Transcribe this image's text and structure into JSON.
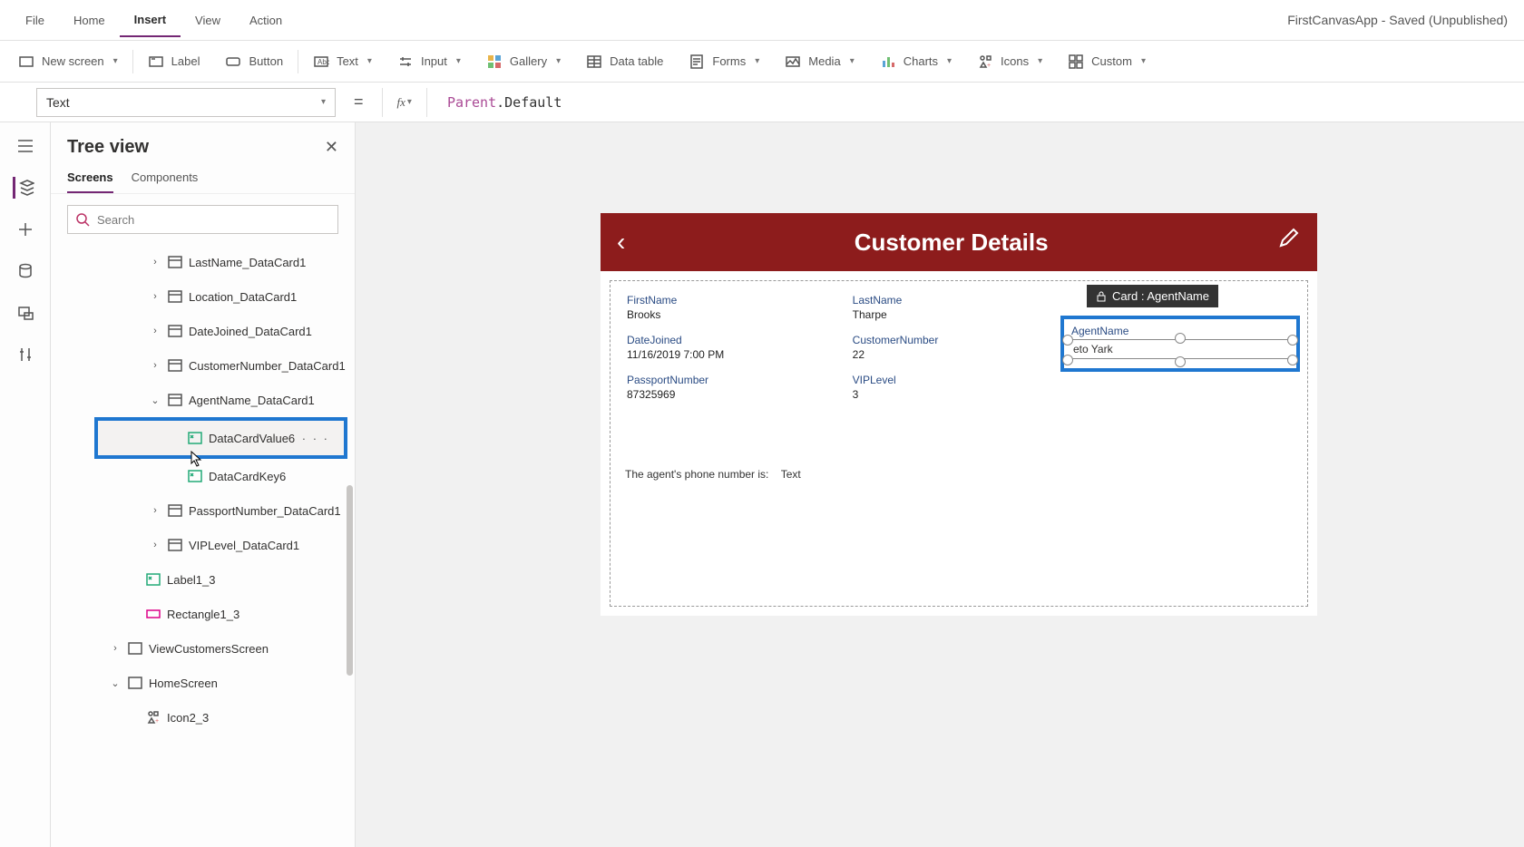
{
  "app": {
    "title": "FirstCanvasApp - Saved (Unpublished)"
  },
  "menu": {
    "file": "File",
    "home": "Home",
    "insert": "Insert",
    "view": "View",
    "action": "Action"
  },
  "ribbon": {
    "newscreen": "New screen",
    "label": "Label",
    "button": "Button",
    "text": "Text",
    "input": "Input",
    "gallery": "Gallery",
    "datatable": "Data table",
    "forms": "Forms",
    "media": "Media",
    "charts": "Charts",
    "icons": "Icons",
    "custom": "Custom"
  },
  "formula": {
    "property": "Text",
    "fx": "fx",
    "expr_tok1": "Parent",
    "expr_tok2": ".Default"
  },
  "treeview": {
    "title": "Tree view",
    "tab_screens": "Screens",
    "tab_components": "Components",
    "search_placeholder": "Search",
    "nodes": {
      "lastname": "LastName_DataCard1",
      "location": "Location_DataCard1",
      "datejoined": "DateJoined_DataCard1",
      "custnum": "CustomerNumber_DataCard1",
      "agent": "AgentName_DataCard1",
      "dcv6": "DataCardValue6",
      "dck6": "DataCardKey6",
      "passport": "PassportNumber_DataCard1",
      "vip": "VIPLevel_DataCard1",
      "label13": "Label1_3",
      "rect13": "Rectangle1_3",
      "viewcust": "ViewCustomersScreen",
      "homescreen": "HomeScreen",
      "icon23": "Icon2_3"
    }
  },
  "canvas": {
    "header_title": "Customer Details",
    "badge": "Card : AgentName",
    "fields": {
      "firstname_lbl": "FirstName",
      "firstname_val": "Brooks",
      "lastname_lbl": "LastName",
      "lastname_val": "Tharpe",
      "datejoined_lbl": "DateJoined",
      "datejoined_val": "11/16/2019 7:00 PM",
      "custnum_lbl": "CustomerNumber",
      "custnum_val": "22",
      "passport_lbl": "PassportNumber",
      "passport_val": "87325969",
      "vip_lbl": "VIPLevel",
      "vip_val": "3",
      "agent_lbl": "AgentName",
      "agent_val": "eto Yark"
    },
    "phone_label": "The agent's phone number is:",
    "phone_value": "Text"
  }
}
